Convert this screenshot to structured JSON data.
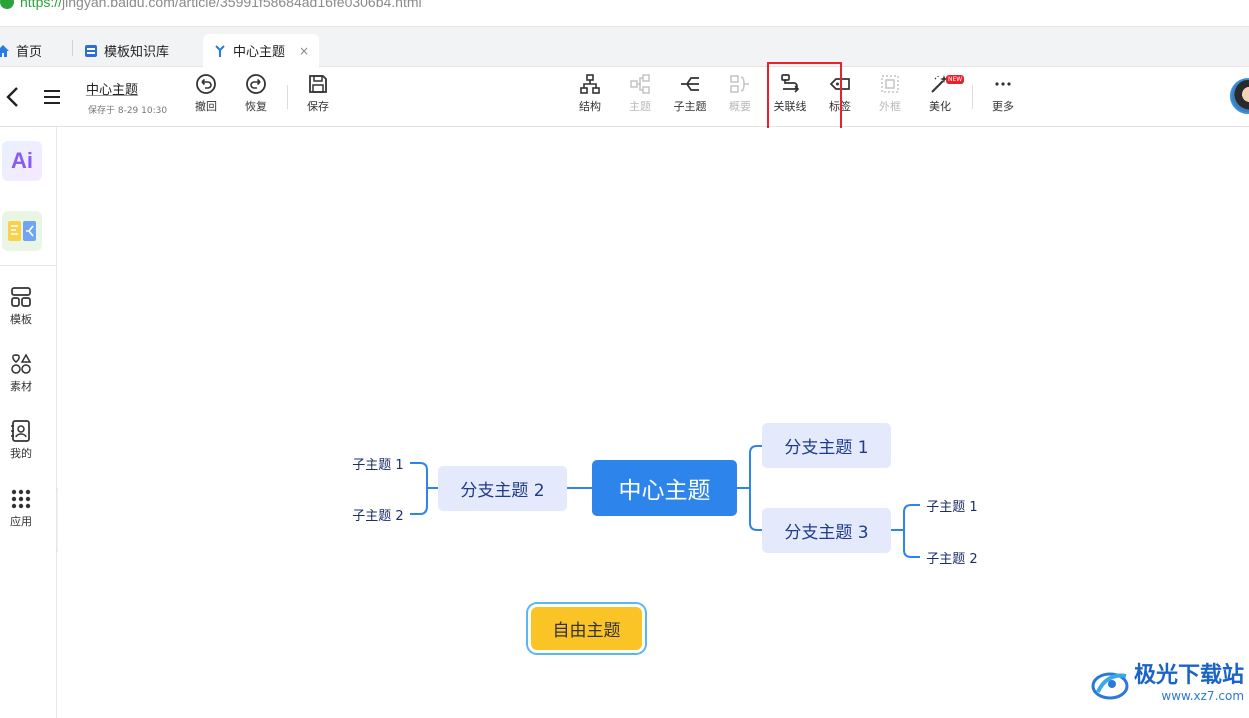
{
  "browser": {
    "url_scheme": "https://",
    "url_rest": "jingyan.baidu.com/article/35991f58684ad16fe0306b4.html"
  },
  "tabs": [
    {
      "label": "首页",
      "icon": "home-icon"
    },
    {
      "label": "模板知识库",
      "icon": "template-library-icon"
    },
    {
      "label": "中心主题",
      "icon": "mindmap-icon",
      "close": "×"
    }
  ],
  "document": {
    "title": "中心主题",
    "saved_text": "保存于 8-29 10:30"
  },
  "toolbar": {
    "undo": "撤回",
    "redo": "恢复",
    "save": "保存",
    "structure": "结构",
    "topic": "主题",
    "subtopic": "子主题",
    "summary": "概要",
    "relation": "关联线",
    "tag": "标签",
    "frame": "外框",
    "beautify": "美化",
    "beautify_badge": "NEW",
    "more": "更多"
  },
  "sidebar": {
    "ai_label": "Ai",
    "items": [
      {
        "label": "模板",
        "icon": "template-icon"
      },
      {
        "label": "素材",
        "icon": "material-icon"
      },
      {
        "label": "我的",
        "icon": "my-files-icon"
      },
      {
        "label": "应用",
        "icon": "apps-grid-icon"
      }
    ]
  },
  "mindmap": {
    "center": "中心主题",
    "branch1": "分支主题 1",
    "branch2": "分支主题 2",
    "branch3": "分支主题 3",
    "b2_sub1": "子主题 1",
    "b2_sub2": "子主题 2",
    "b3_sub1": "子主题 1",
    "b3_sub2": "子主题 2",
    "free_topic": "自由主题"
  },
  "watermark": {
    "name": "极光下载站",
    "site": "www.xz7.com"
  },
  "colors": {
    "accent": "#2d84ea",
    "branch_bg": "#e4eafb",
    "free_topic_bg": "#fbc426",
    "highlight": "#e8212a"
  }
}
